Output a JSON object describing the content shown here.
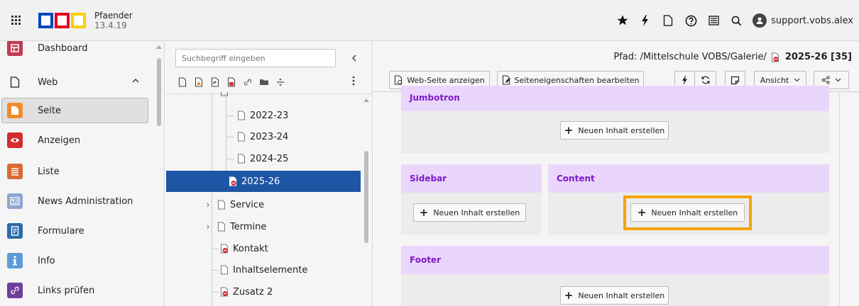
{
  "app": {
    "name": "Pfaender",
    "version": "13.4.19",
    "user": "support.vobs.alex",
    "logo_colors": [
      "#0047b8",
      "#e5001d",
      "#ffcf00"
    ]
  },
  "topbar_icons": [
    "grid-icon",
    "star-icon",
    "flash-icon",
    "file-icon",
    "help-icon",
    "list-icon",
    "search-icon",
    "user-icon"
  ],
  "modules": [
    {
      "label": "Dashboard",
      "icon": "dashboard-icon",
      "color": "#c13a4f"
    },
    {
      "label": "Web",
      "icon": "page-icon",
      "color": ""
    },
    {
      "label": "Seite",
      "icon": "page-icon",
      "color": "#f28c28"
    },
    {
      "label": "Anzeigen",
      "icon": "eye-icon",
      "color": "#d42c30"
    },
    {
      "label": "Liste",
      "icon": "list-icon",
      "color": "#d86b34"
    },
    {
      "label": "News Administration",
      "icon": "news-icon",
      "color": "#8ea5ce"
    },
    {
      "label": "Formulare",
      "icon": "form-icon",
      "color": "#2d6aa9"
    },
    {
      "label": "Info",
      "icon": "info-icon",
      "color": "#5b9bd8"
    },
    {
      "label": "Links prüfen",
      "icon": "link-icon",
      "color": "#6f3f9c"
    }
  ],
  "tree": {
    "search_placeholder": "Suchbegriff eingeben",
    "items": [
      {
        "label": "2022-23",
        "type": "page",
        "indent": 2
      },
      {
        "label": "2023-24",
        "type": "page",
        "indent": 2
      },
      {
        "label": "2024-25",
        "type": "page",
        "indent": 2
      },
      {
        "label": "2025-26",
        "type": "page-hidden",
        "indent": 2,
        "selected": true
      },
      {
        "label": "Service",
        "type": "page",
        "indent": 1,
        "expandable": true
      },
      {
        "label": "Termine",
        "type": "page",
        "indent": 1,
        "expandable": true
      },
      {
        "label": "Kontakt",
        "type": "page-hidden",
        "indent": 1
      },
      {
        "label": "Inhaltselemente",
        "type": "page",
        "indent": 1
      },
      {
        "label": "Zusatz 2",
        "type": "page-hidden",
        "indent": 1
      }
    ]
  },
  "content": {
    "path_label": "Pfad: /Mittelschule VOBS/Galerie/",
    "path_page": "2025-26 [35]",
    "buttons": {
      "view": "Web-Seite anzeigen",
      "edit_props": "Seiteneigenschaften bearbeiten",
      "view_mode": "Ansicht"
    },
    "columns": {
      "jumbotron": "Jumbotron",
      "sidebar": "Sidebar",
      "content": "Content",
      "footer": "Footer"
    },
    "new_content_label": "Neuen Inhalt erstellen",
    "colors": {
      "column_header": "#ead6fb",
      "column_header_text": "#7d1ac9",
      "highlight": "#f5a30f",
      "selected_tree": "#1e56a5"
    }
  }
}
